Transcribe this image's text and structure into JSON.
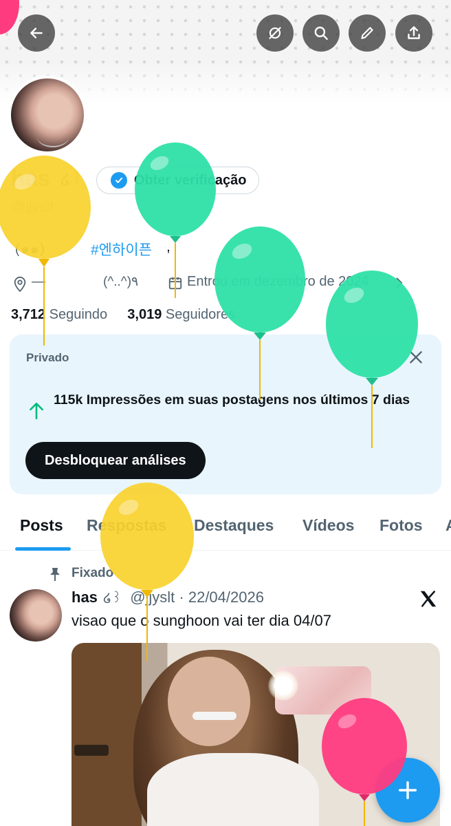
{
  "profile": {
    "name": "has",
    "name_glyph": "໒꒱",
    "verify_label": "Obter verificação",
    "handle": "@jjyslt",
    "bio_decor": "(๑๑)",
    "bio_hashtag": "#엔하이픈",
    "bio_comma": ",",
    "location": "—",
    "location_extra": "(^..^)٩",
    "joined": "Entrou em dezembro de 2024",
    "following_count": "3,712",
    "following_label": "Seguindo",
    "followers_count": "3,019",
    "followers_label": "Seguidores"
  },
  "card": {
    "label": "Privado",
    "impressions_text": "115k Impressões em suas postagens nos últimos 7 dias",
    "button_label": "Desbloquear análises"
  },
  "tabs": [
    {
      "label": "Posts",
      "active": true
    },
    {
      "label": "Respostas",
      "active": false
    },
    {
      "label": "Destaques",
      "active": false
    },
    {
      "label": "Vídeos",
      "active": false
    },
    {
      "label": "Fotos",
      "active": false
    },
    {
      "label": "A",
      "active": false
    }
  ],
  "post": {
    "pinned_label": "Fixado",
    "author": "has",
    "author_glyph": "໒꒱",
    "meta": "@jjyslt · 22/04/2026",
    "text": "visao que o sunghoon vai ter dia 04/07"
  },
  "icons": {
    "back": "arrow-left-icon",
    "mute": "strikethrough-circle-icon",
    "search": "search-icon",
    "edit": "pencil-icon",
    "share": "share-upload-icon",
    "verified": "verified-check-icon",
    "location": "location-pin-icon",
    "calendar": "calendar-icon",
    "close": "close-icon",
    "trend": "arrow-up-icon",
    "pin": "pin-icon",
    "x_logo": "x-logo-icon",
    "compose": "plus-icon"
  },
  "colors": {
    "accent": "#1d9bf0",
    "card_bg": "#e8f5fd",
    "text_primary": "#0f1419",
    "text_secondary": "#536471",
    "balloon_yellow": "#f9d12e",
    "balloon_teal": "#2ee0a6",
    "balloon_pink": "#ff3b7f"
  }
}
